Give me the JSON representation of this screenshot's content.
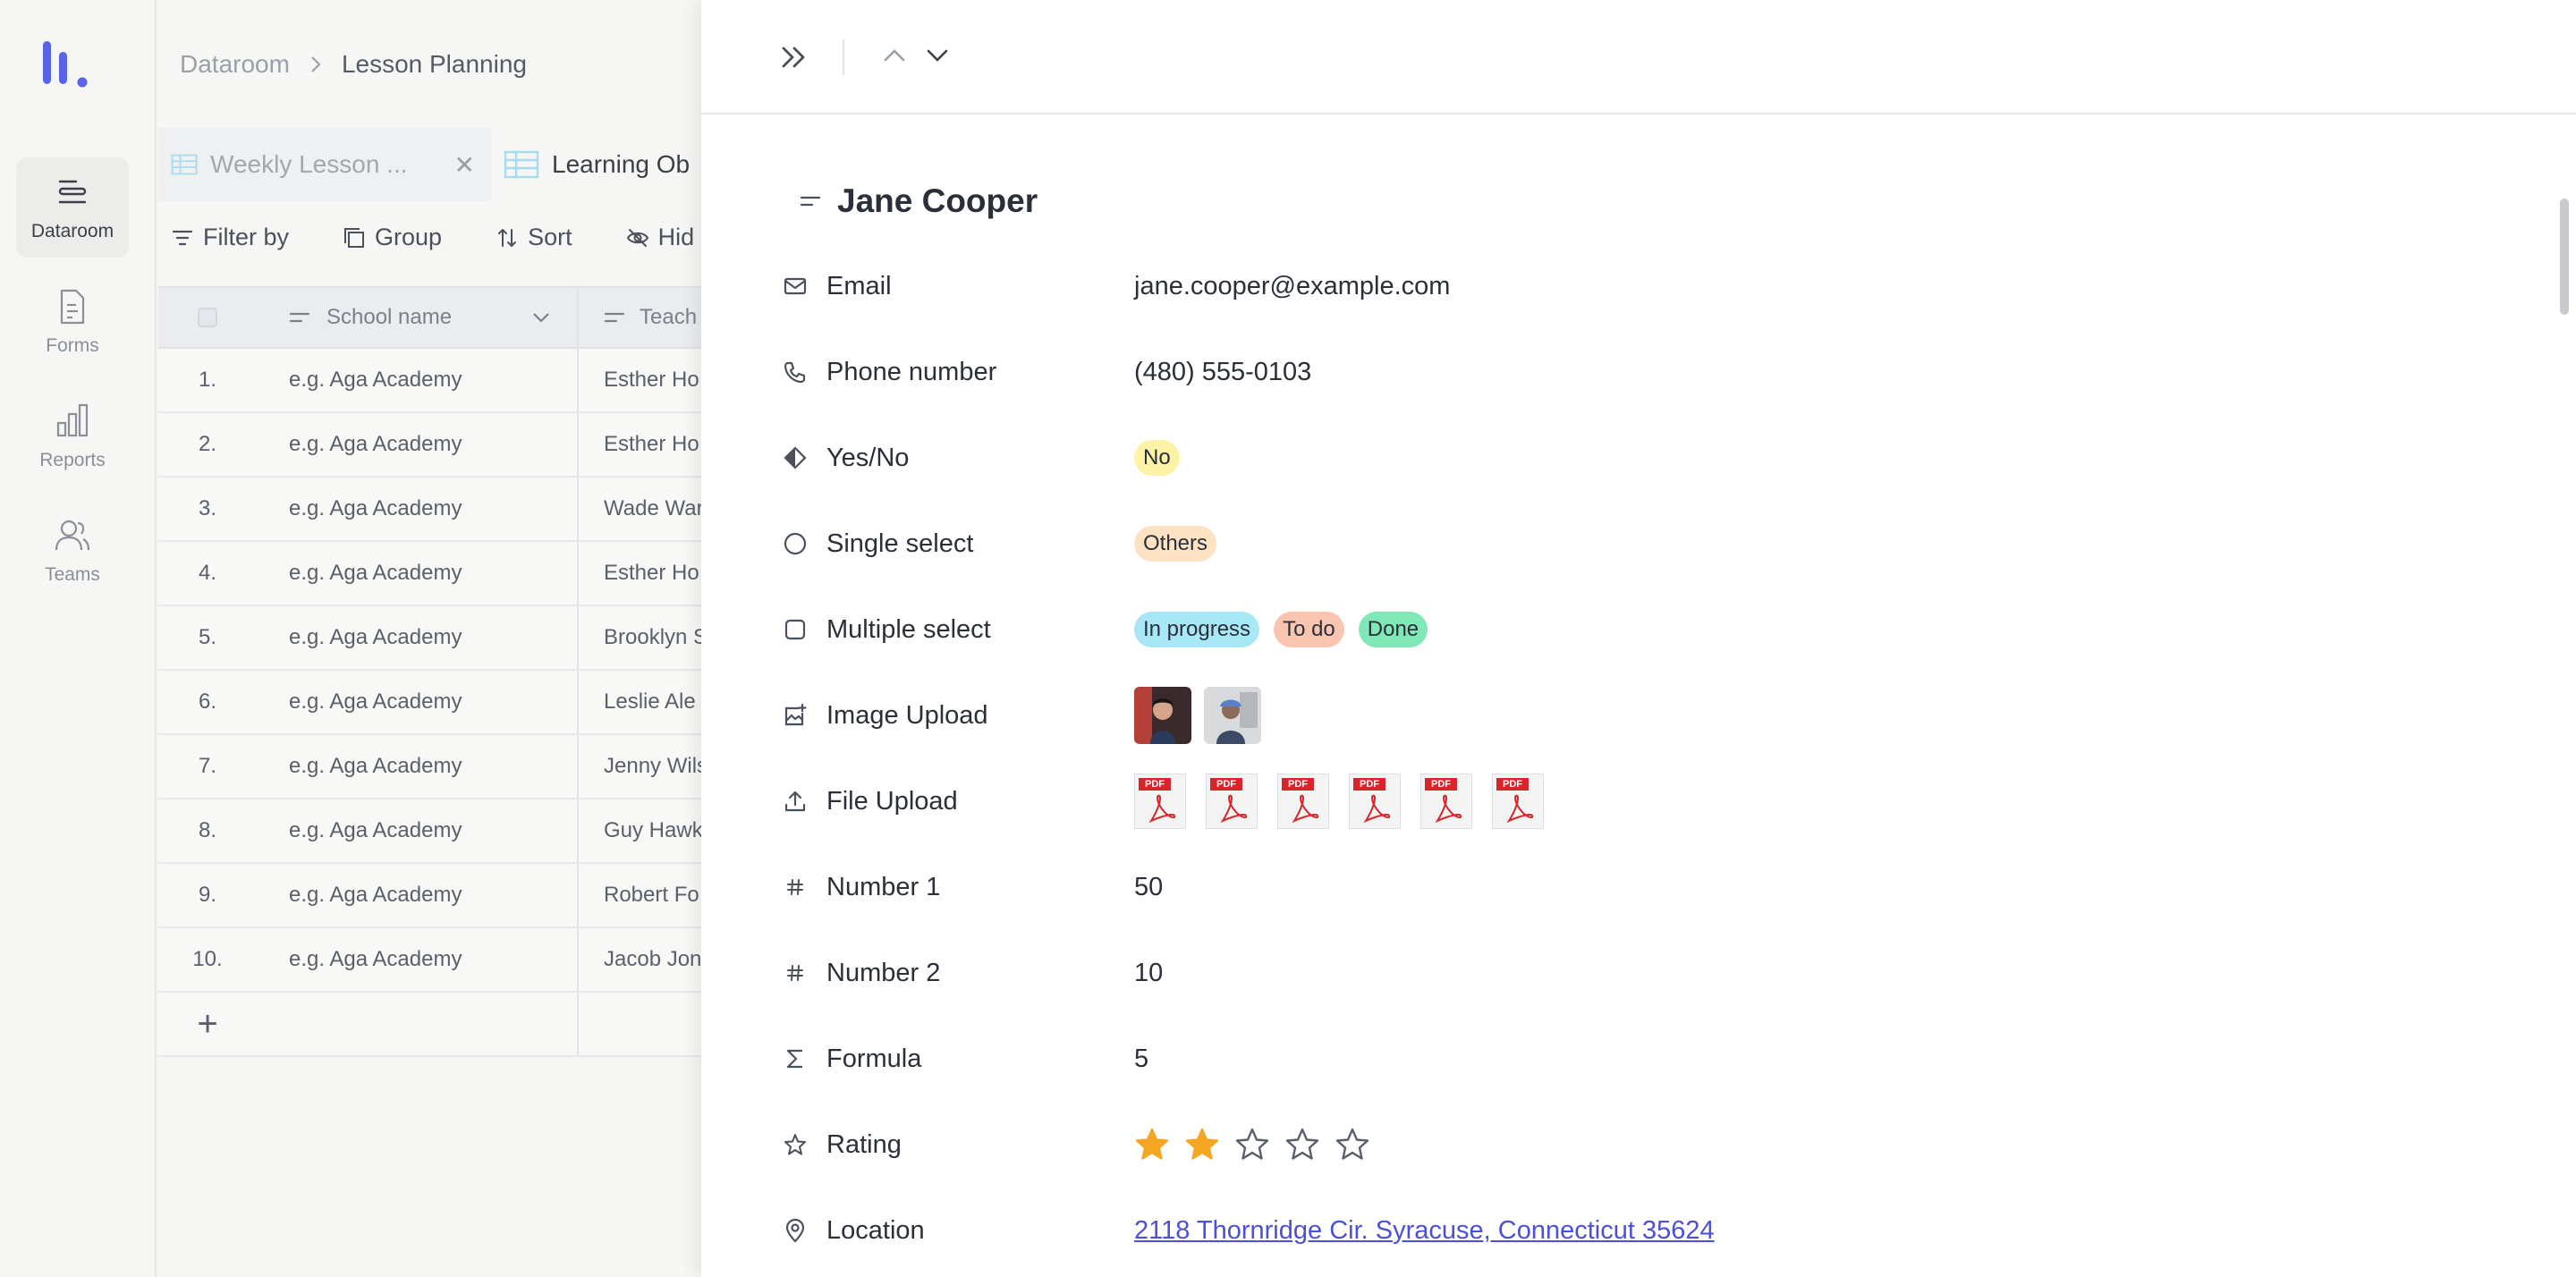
{
  "rail": {
    "items": [
      {
        "label": "Dataroom",
        "icon": "dataroom-icon",
        "active": true
      },
      {
        "label": "Forms",
        "icon": "forms-icon",
        "active": false
      },
      {
        "label": "Reports",
        "icon": "reports-icon",
        "active": false
      },
      {
        "label": "Teams",
        "icon": "teams-icon",
        "active": false
      }
    ],
    "accent": "#5b63e8"
  },
  "breadcrumb": {
    "root": "Dataroom",
    "current": "Lesson Planning"
  },
  "tabs": [
    {
      "label": "Weekly Lesson ...",
      "closable": true
    },
    {
      "label": "Learning Ob"
    }
  ],
  "toolbar": {
    "filter": "Filter by",
    "group": "Group",
    "sort": "Sort",
    "hide": "Hid"
  },
  "table": {
    "columns": [
      "School name",
      "Teach"
    ],
    "rows": [
      {
        "num": "1.",
        "school": "e.g. Aga Academy",
        "teacher": "Esther Ho"
      },
      {
        "num": "2.",
        "school": "e.g. Aga Academy",
        "teacher": "Esther Ho"
      },
      {
        "num": "3.",
        "school": "e.g. Aga Academy",
        "teacher": "Wade War"
      },
      {
        "num": "4.",
        "school": "e.g. Aga Academy",
        "teacher": "Esther Ho"
      },
      {
        "num": "5.",
        "school": "e.g. Aga Academy",
        "teacher": "Brooklyn S"
      },
      {
        "num": "6.",
        "school": "e.g. Aga Academy",
        "teacher": "Leslie Ale"
      },
      {
        "num": "7.",
        "school": "e.g. Aga Academy",
        "teacher": "Jenny Wils"
      },
      {
        "num": "8.",
        "school": "e.g. Aga Academy",
        "teacher": "Guy Hawk"
      },
      {
        "num": "9.",
        "school": "e.g. Aga Academy",
        "teacher": "Robert Fo"
      },
      {
        "num": "10.",
        "school": "e.g. Aga Academy",
        "teacher": "Jacob Jon"
      }
    ],
    "add_label": "+"
  },
  "record": {
    "title": "Jane Cooper",
    "email_label": "Email",
    "email": "jane.cooper@example.com",
    "phone_label": "Phone number",
    "phone": "(480) 555-0103",
    "yesno_label": "Yes/No",
    "yesno": "No",
    "single_label": "Single select",
    "single": "Others",
    "multi_label": "Multiple select",
    "multi": [
      "In progress",
      "To do",
      "Done"
    ],
    "image_label": "Image Upload",
    "file_label": "File Upload",
    "file_badge": "PDF",
    "number1_label": "Number 1",
    "number1": "50",
    "number2_label": "Number 2",
    "number2": "10",
    "formula_label": "Formula",
    "formula": "5",
    "rating_label": "Rating",
    "rating": 2,
    "rating_max": 5,
    "location_label": "Location",
    "location": "2118 Thornridge Cir. Syracuse, Connecticut 35624"
  },
  "colors": {
    "yes_no_bg": "#fdf3a6",
    "single_bg": "#fde3c4",
    "in_progress_bg": "#a8e8f6",
    "todo_bg": "#f9c4b0",
    "done_bg": "#7fe8b6",
    "star": "#f5a623",
    "link": "#4b51d6"
  }
}
